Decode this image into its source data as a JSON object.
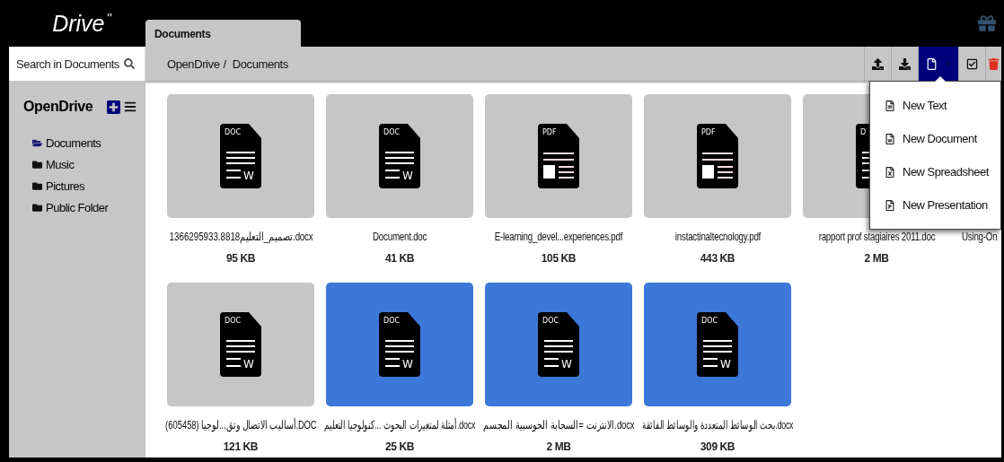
{
  "logo": {
    "text": "Drive$^{''}$"
  },
  "tabs": [
    {
      "label": "Documents",
      "selected": true
    }
  ],
  "search": {
    "placeholder": "Search in Documents"
  },
  "breadcrumb": {
    "separator": "/",
    "items": [
      {
        "label": "OpenDrive"
      },
      {
        "label": "Documents"
      }
    ]
  },
  "toolbar": [
    {
      "kind": "upload",
      "selected": false
    },
    {
      "kind": "download",
      "selected": false
    },
    {
      "kind": "new",
      "selected": true
    },
    {
      "kind": "select",
      "selected": false
    },
    {
      "kind": "delete",
      "selected": false
    }
  ],
  "new_menu": [
    {
      "kind": "text",
      "label": "New Text"
    },
    {
      "kind": "document",
      "label": "New Document"
    },
    {
      "kind": "spreadsheet",
      "label": "New Spreadsheet"
    },
    {
      "kind": "presentation",
      "label": "New Presentation"
    }
  ],
  "sidebar": {
    "title": "OpenDrive",
    "items": [
      {
        "label": "Documents",
        "selected": true
      },
      {
        "label": "Music",
        "selected": false
      },
      {
        "label": "Pictures",
        "selected": false
      },
      {
        "label": "Public Folder",
        "selected": false
      }
    ]
  },
  "files": [
    {
      "kind": "doc",
      "icon_label": "DOC",
      "icon_letter": "W",
      "name": "1366295933.8818تصميم_التعليم.docx",
      "size": "95 KB",
      "selected": false
    },
    {
      "kind": "doc",
      "icon_label": "DOC",
      "icon_letter": "W",
      "name": "Document.doc",
      "size": "41 KB",
      "selected": false
    },
    {
      "kind": "pdf",
      "icon_label": "PDF",
      "name": "E-learning_devel...experiences.pdf",
      "size": "105 KB",
      "selected": false
    },
    {
      "kind": "pdf",
      "icon_label": "PDF",
      "name": "instactinaltecnology.pdf",
      "size": "443 KB",
      "selected": false
    },
    {
      "kind": "doc",
      "icon_label": "D",
      "name": "rapport prof stagiaires 2011.doc",
      "size": "2 MB",
      "selected": false
    },
    {
      "name": "Using-On"
    },
    {
      "kind": "doc",
      "icon_label": "DOC",
      "icon_letter": "W",
      "name": "أساليب الاتصال وتق...لوجيا (605458).DOC",
      "size": "121 KB",
      "selected": false
    },
    {
      "kind": "doc",
      "icon_label": "DOC",
      "icon_letter": "W",
      "name": "أمثلة لمتغيرات البحوث ...كنولوجيا التعليم.docx",
      "size": "25 KB",
      "selected": true
    },
    {
      "kind": "doc",
      "icon_label": "DOC",
      "icon_letter": "W",
      "name": "الانترنت =السحابة الحوسبية المجسم.docx",
      "size": "2 MB",
      "selected": true
    },
    {
      "kind": "doc",
      "icon_label": "DOC",
      "icon_letter": "W",
      "name": "بحث الوسائط المتعددة والوسائط الفائقة.docx",
      "size": "309 KB",
      "selected": true
    }
  ]
}
